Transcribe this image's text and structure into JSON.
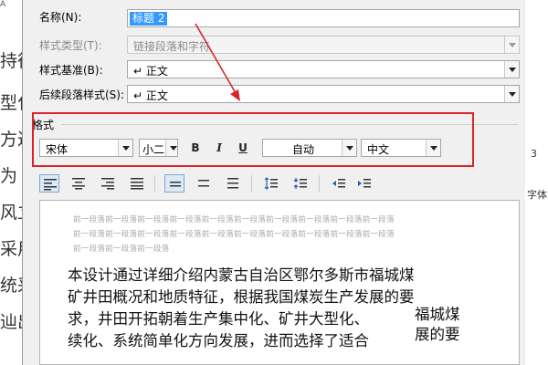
{
  "background": {
    "top_label": "A",
    "left_lines": [
      "持徉",
      "型化",
      "方过",
      "为 9",
      "风立",
      "采用",
      "统采",
      "辿出"
    ],
    "right_number": "3",
    "right_label": "字体"
  },
  "dialog": {
    "name_label": "名称(N):",
    "name_value": "标题 2",
    "style_type_label": "样式类型(T):",
    "style_type_value": "链接段落和字符",
    "based_on_label": "样式基准(B):",
    "based_on_value": "↵ 正文",
    "next_style_label": "后续段落样式(S):",
    "next_style_value": "↵ 正文",
    "format_title": "格式",
    "font": "宋体",
    "size": "小二",
    "bold": "B",
    "italic": "I",
    "underline": "U",
    "color": "自动",
    "language": "中文"
  },
  "preview": {
    "prev_lines": [
      "前一段落前一段落前一段落前一段落前一段落前一段落前一段落前一段落前一段落前一段落",
      "前一段落前一段落前一段落前一段落前一段落前一段落前一段落前一段落前一段落前一段落",
      "前一段落前一段落前一段落"
    ],
    "text_lines": [
      "本设计通过详细介绍内蒙古自治区鄂尔多斯市福城煤",
      "矿井田概况和地质特征，根据我国煤炭生产发展的要",
      "求，井田开拓朝着生产集中化、矿井大型化、",
      "续化、系统简单化方向发展，进而选择了适合"
    ],
    "float_lines": [
      "福城煤",
      "展的要"
    ]
  }
}
